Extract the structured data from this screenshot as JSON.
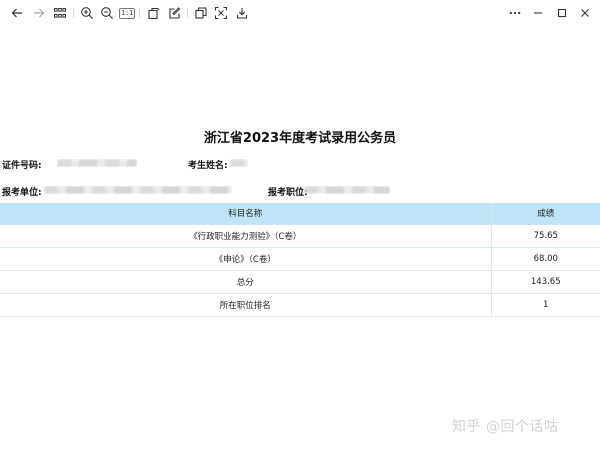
{
  "toolbar": {
    "buttons": [
      {
        "name": "back-button",
        "icon": "arrow-left-icon"
      },
      {
        "name": "forward-button",
        "icon": "arrow-right-icon"
      },
      {
        "name": "thumbnails-button",
        "icon": "grid-icon"
      },
      {
        "name": "zoom-in-button",
        "icon": "zoom-in-icon"
      },
      {
        "name": "zoom-out-button",
        "icon": "zoom-out-icon"
      },
      {
        "name": "actual-size-button",
        "icon": "actual-size-icon",
        "text": "1:1"
      },
      {
        "name": "rotate-button",
        "icon": "rotate-icon"
      },
      {
        "name": "edit-button",
        "icon": "edit-icon"
      },
      {
        "name": "copy-button",
        "icon": "copy-icon"
      },
      {
        "name": "screenshot-ocr-button",
        "icon": "scan-icon"
      },
      {
        "name": "download-button",
        "icon": "download-icon"
      }
    ],
    "window_buttons": [
      {
        "name": "more-button",
        "icon": "more-icon"
      },
      {
        "name": "minimize-button",
        "icon": "minimize-icon"
      },
      {
        "name": "maximize-button",
        "icon": "maximize-icon"
      },
      {
        "name": "close-button",
        "icon": "close-icon"
      }
    ]
  },
  "document": {
    "title": "浙江省2023年度考试录用公务员",
    "fields": {
      "id_label": "证件号码:",
      "name_label": "考生姓名:",
      "unit_label": "报考单位:",
      "position_label": "报考职位:"
    },
    "table": {
      "headers": {
        "subject": "科目名称",
        "score": "成绩"
      },
      "rows": [
        {
          "subject": "《行政职业能力测验》（C卷）",
          "score": "75.65"
        },
        {
          "subject": "《申论》（C卷）",
          "score": "68.00"
        },
        {
          "subject": "总分",
          "score": "143.65"
        },
        {
          "subject": "所在职位排名",
          "score": "1"
        }
      ]
    }
  },
  "watermark": "知乎 @回个话咕",
  "colors": {
    "table_header_bg": "#bfe4f5",
    "table_border": "#dbe9f0",
    "watermark": "#d2d2d2"
  }
}
